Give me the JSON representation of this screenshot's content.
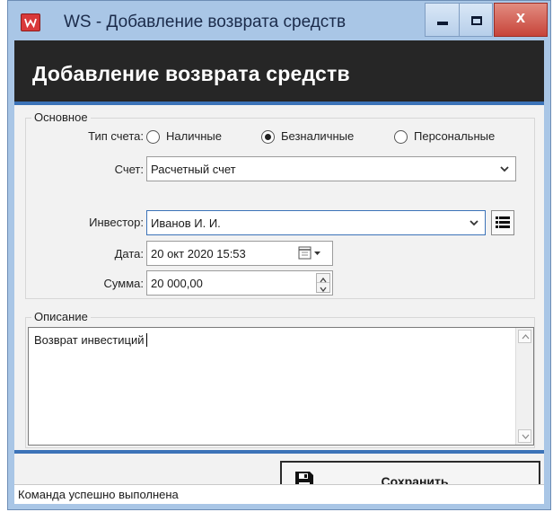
{
  "window": {
    "title": "WS - Добавление возврата средств",
    "icon": "app-logo-icon",
    "close_glyph": "x",
    "colors": {
      "frame": "#a9c6e6",
      "close": "#c7443a",
      "banner": "#262626",
      "accent": "#3c73b8"
    }
  },
  "header": {
    "title": "Добавление возврата средств"
  },
  "main_group": {
    "legend": "Основное",
    "account_type": {
      "label": "Тип счета:",
      "options": [
        {
          "label": "Наличные",
          "checked": false
        },
        {
          "label": "Безналичные",
          "checked": true
        },
        {
          "label": "Персональные",
          "checked": false
        }
      ]
    },
    "account": {
      "label": "Счет:",
      "value": "Расчетный счет"
    },
    "investor": {
      "label": "Инвестор:",
      "value": "Иванов И. И."
    },
    "date": {
      "label": "Дата:",
      "value": "20 окт  2020  15:53"
    },
    "amount": {
      "label": "Сумма:",
      "value": "20 000,00"
    }
  },
  "description_group": {
    "legend": "Описание",
    "value": "Возврат инвестиций"
  },
  "actions": {
    "save_label": "Сохранить",
    "save_icon": "floppy-disk-icon"
  },
  "status": {
    "text": "Команда успешно выполнена"
  }
}
